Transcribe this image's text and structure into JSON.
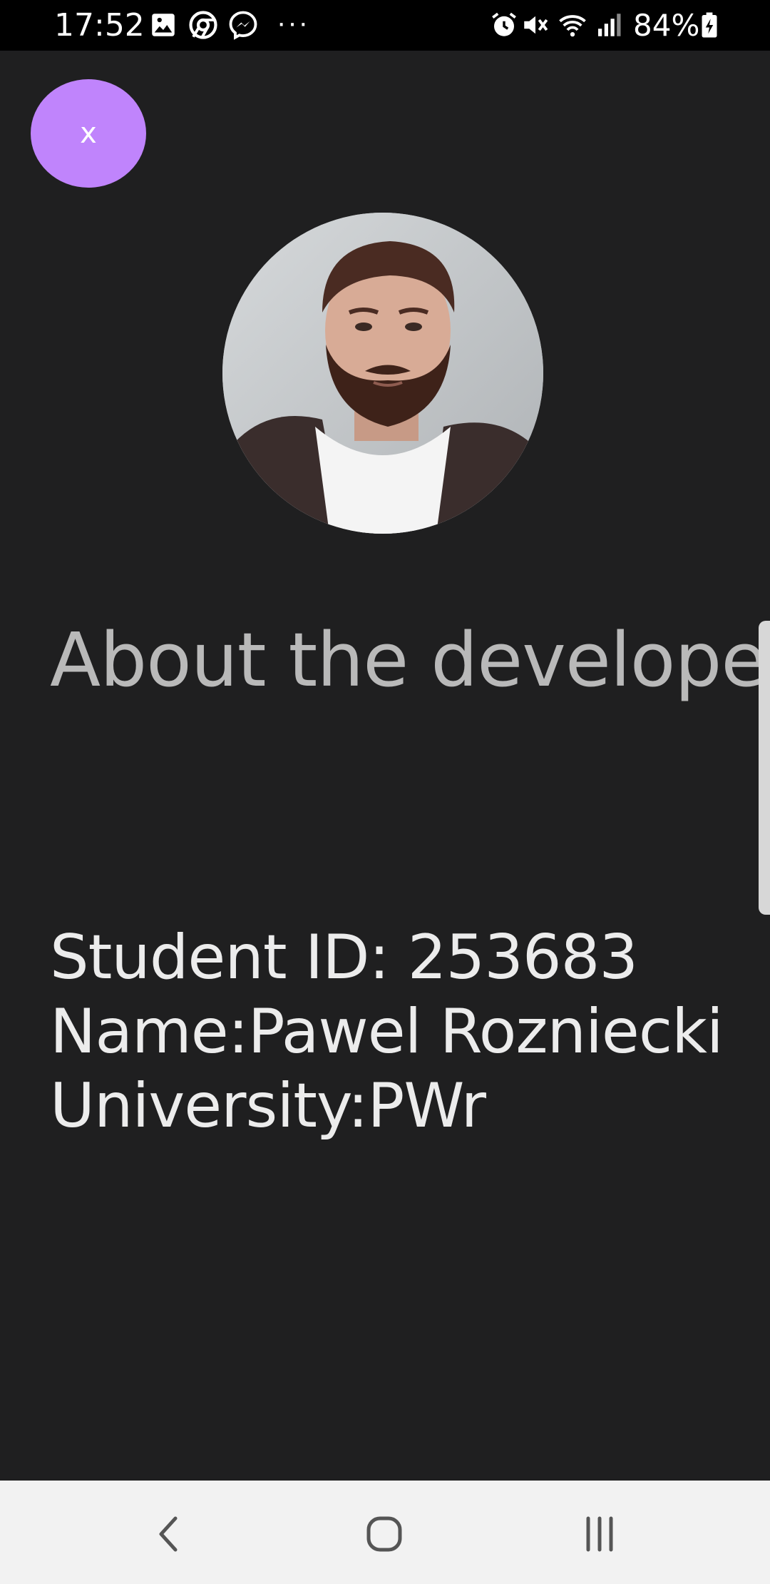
{
  "status_bar": {
    "time": "17:52",
    "battery_percent": "84%",
    "overflow": "···",
    "icons": [
      "gallery-icon",
      "chrome-icon",
      "messenger-icon",
      "alarm-icon",
      "mute-icon",
      "wifi-icon",
      "signal-icon",
      "battery-icon"
    ]
  },
  "close_button": {
    "label": "x",
    "color": "#c084fc"
  },
  "heading": "About the developer",
  "info": {
    "student_id": "Student ID: 253683",
    "name": "Name:Pawel Rozniecki",
    "university": "University:PWr"
  },
  "nav_bar": {
    "icons": [
      "back-icon",
      "home-icon",
      "recents-icon"
    ]
  },
  "colors": {
    "background": "#1f1f20",
    "accent": "#c084fc",
    "heading": "#b9b9b9",
    "text": "#ececec"
  }
}
